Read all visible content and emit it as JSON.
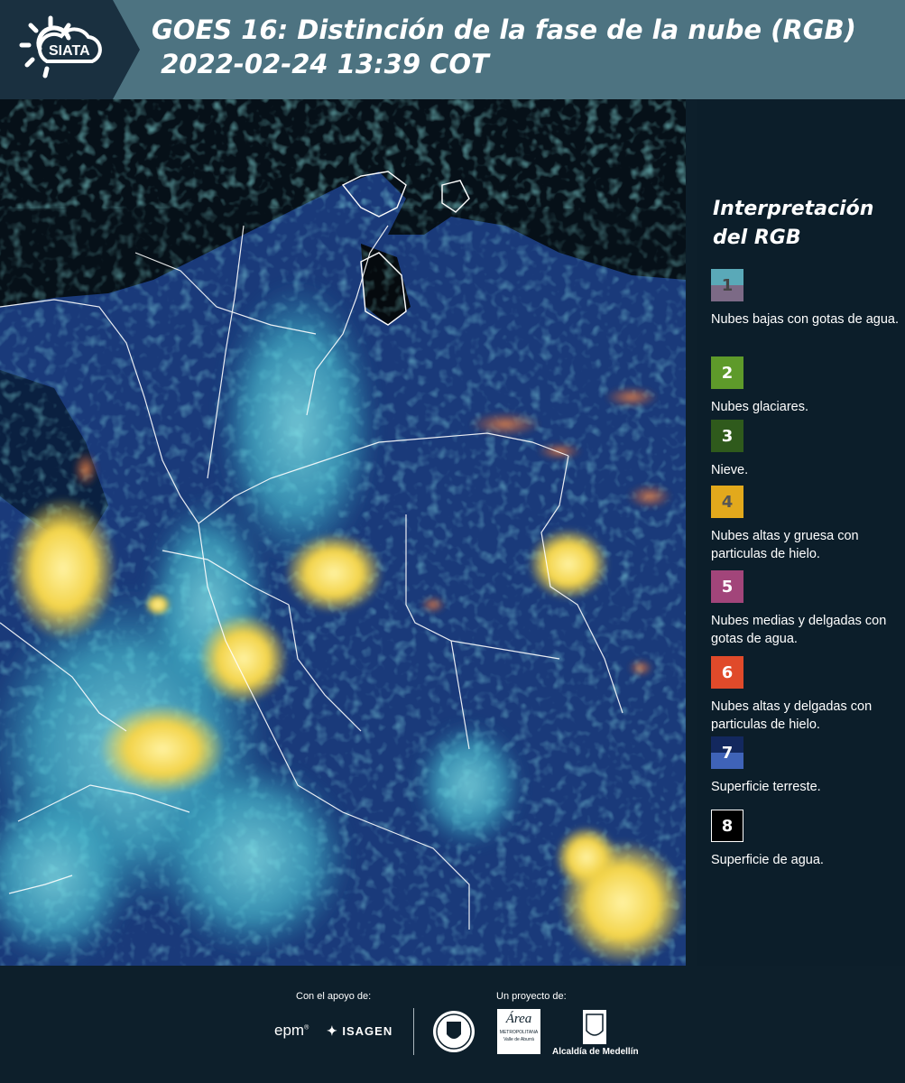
{
  "header": {
    "logo_text": "SIATA",
    "title_line1": "GOES 16: Distinción de la fase de la nube (RGB)",
    "title_line2": " 2022-02-24 13:39 COT"
  },
  "legend": {
    "title": "Interpretación del RGB",
    "items": [
      {
        "number": "1",
        "label": "Nubes bajas con gotas de agua.",
        "color_top": "#5aa9b8",
        "color_bottom": "#7c6a86",
        "number_color": "#444444"
      },
      {
        "number": "2",
        "label": "Nubes glaciares.",
        "color_top": "#5e9a2a",
        "color_bottom": "#5e9a2a",
        "number_color": "#ffffff"
      },
      {
        "number": "3",
        "label": "Nieve.",
        "color_top": "#2f5a1c",
        "color_bottom": "#2f5a1c",
        "number_color": "#ffffff"
      },
      {
        "number": "4",
        "label": "Nubes altas y gruesa con particulas de hielo.",
        "color_top": "#e2a91c",
        "color_bottom": "#e2a91c",
        "number_color": "#555555"
      },
      {
        "number": "5",
        "label": "Nubes medias y delgadas con gotas de agua.",
        "color_top": "#a2457a",
        "color_bottom": "#a2457a",
        "number_color": "#ffffff"
      },
      {
        "number": "6",
        "label": "Nubes altas y delgadas con particulas de hielo.",
        "color_top": "#e04a2a",
        "color_bottom": "#e04a2a",
        "number_color": "#ffffff"
      },
      {
        "number": "7",
        "label": "Superficie terreste.",
        "color_top": "#13285e",
        "color_bottom": "#3f63b8",
        "number_color": "#ffffff"
      },
      {
        "number": "8",
        "label": "Superficie de agua.",
        "color_top": "#000000",
        "color_bottom": "#000000",
        "number_color": "#ffffff"
      }
    ]
  },
  "footer": {
    "support_label": "Con el apoyo de:",
    "project_label": "Un proyecto de:",
    "epm": "epm",
    "isagen": "ISAGEN",
    "area_line1": "Área",
    "area_line2": "METROPOLITANA",
    "area_line3": "Valle de Aburrá",
    "alcaldia": "Alcaldía de Medellín"
  }
}
